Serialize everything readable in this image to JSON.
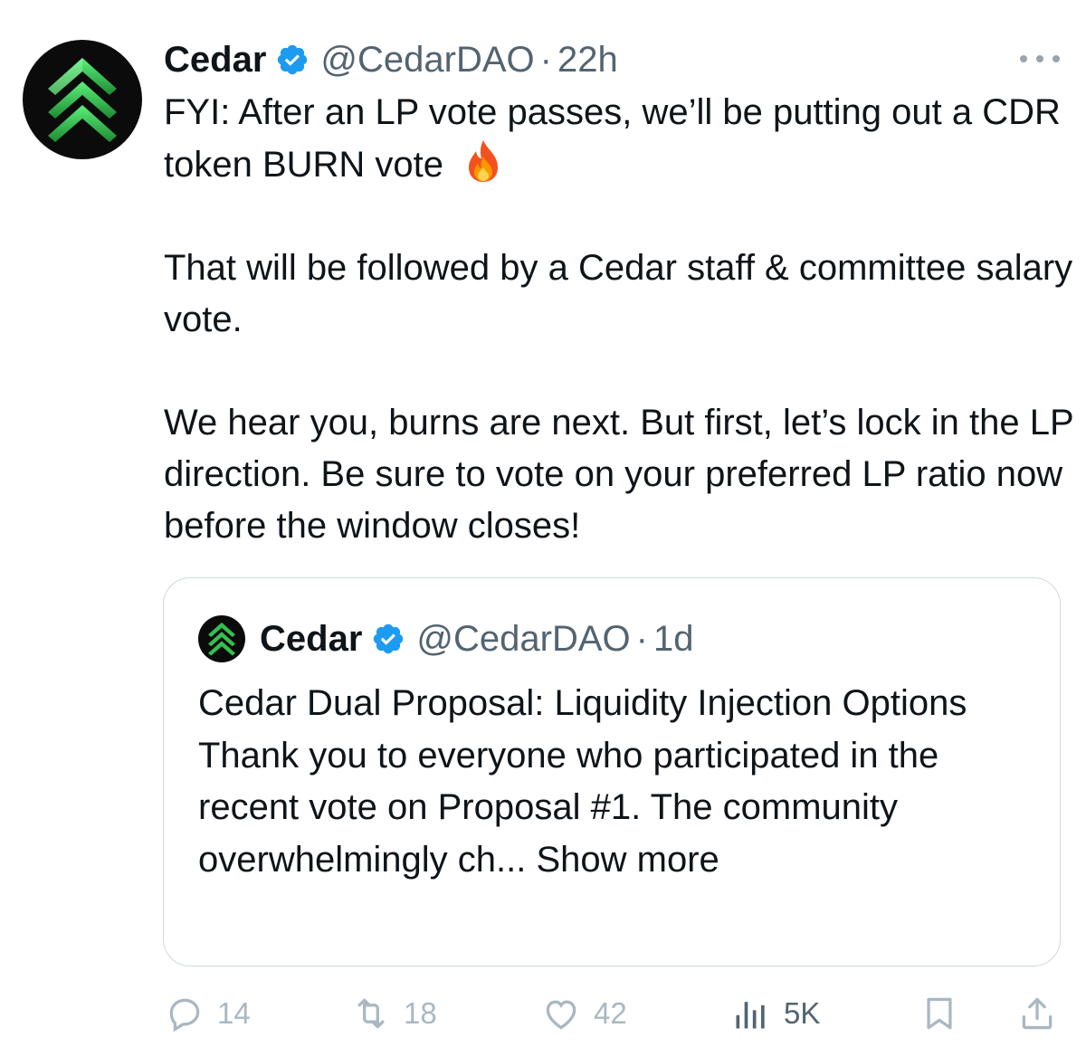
{
  "tweet": {
    "author_name": "Cedar",
    "author_handle": "@CedarDAO",
    "separator": "·",
    "time": "22h",
    "paragraphs": [
      "FYI: After an LP vote passes, we’ll be putting out a CDR token BURN vote",
      "That will be followed by a Cedar staff & committee salary vote.",
      "We hear you, burns are next. But first, let’s lock in the LP direction. Be sure to vote on your preferred LP ratio now before the window closes!"
    ],
    "quoted": {
      "author_name": "Cedar",
      "author_handle": "@CedarDAO",
      "separator": "·",
      "time": "1d",
      "title": "Cedar Dual Proposal: Liquidity Injection Options",
      "text": "Thank you to everyone who participated in the recent vote on Proposal #1. The community overwhelmingly ch...",
      "show_more": "Show more"
    },
    "actions": {
      "replies": "14",
      "retweets": "18",
      "likes": "42",
      "views": "5K"
    }
  },
  "colors": {
    "verified": "#1d9bf0",
    "brand_green": "#3fd25a",
    "muted": "#536471",
    "faint": "#aab8c2"
  },
  "icons": [
    "more-icon",
    "verified-badge-icon",
    "fire-emoji-icon",
    "reply-icon",
    "retweet-icon",
    "like-icon",
    "views-icon",
    "bookmark-icon",
    "share-icon"
  ]
}
